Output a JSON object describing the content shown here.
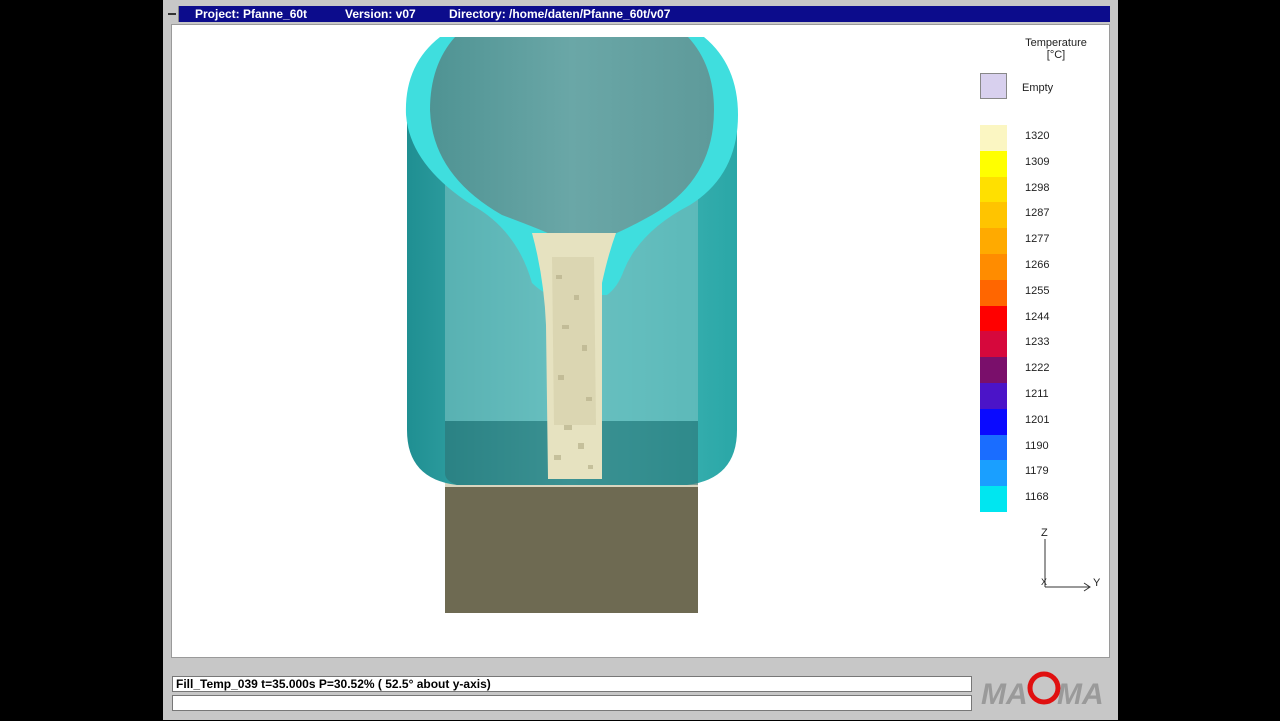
{
  "titlebar": {
    "project": "Project: Pfanne_60t",
    "version": "Version: v07",
    "directory": "Directory: /home/daten/Pfanne_60t/v07"
  },
  "legend": {
    "title_line1": "Temperature",
    "title_line2": "[°C]",
    "empty_label": "Empty",
    "empty_color": "#d8d0ee",
    "entries": [
      {
        "label": "1320",
        "color": "#fbf6c2"
      },
      {
        "label": "1309",
        "color": "#ffff00"
      },
      {
        "label": "1298",
        "color": "#ffe000"
      },
      {
        "label": "1287",
        "color": "#ffc400"
      },
      {
        "label": "1277",
        "color": "#ffaa00"
      },
      {
        "label": "1266",
        "color": "#ff8c00"
      },
      {
        "label": "1255",
        "color": "#ff6600"
      },
      {
        "label": "1244",
        "color": "#ff0000"
      },
      {
        "label": "1233",
        "color": "#d6083c"
      },
      {
        "label": "1222",
        "color": "#7a0f6b"
      },
      {
        "label": "1211",
        "color": "#4b14c8"
      },
      {
        "label": "1201",
        "color": "#0a0aff"
      },
      {
        "label": "1190",
        "color": "#1a6dff"
      },
      {
        "label": "1179",
        "color": "#1a9fff"
      },
      {
        "label": "1168",
        "color": "#00e6f0"
      }
    ]
  },
  "axes": {
    "z_label": "Z",
    "y_label": "Y",
    "x_label": "X"
  },
  "status": {
    "line1": "Fill_Temp_039 t=35.000s P=30.52% ( 52.5° about y-axis)",
    "line2": ""
  },
  "logo": {
    "text_left": "MA",
    "text_g": "G",
    "text_right": "MA",
    "g_color": "#e01010"
  },
  "colors": {
    "ladle_outer": "#2aa7a7",
    "ladle_rim": "#3fdede",
    "ladle_inner": "#5e9a9a",
    "melt": "#e6e2c0",
    "base": "#6e6a52"
  }
}
